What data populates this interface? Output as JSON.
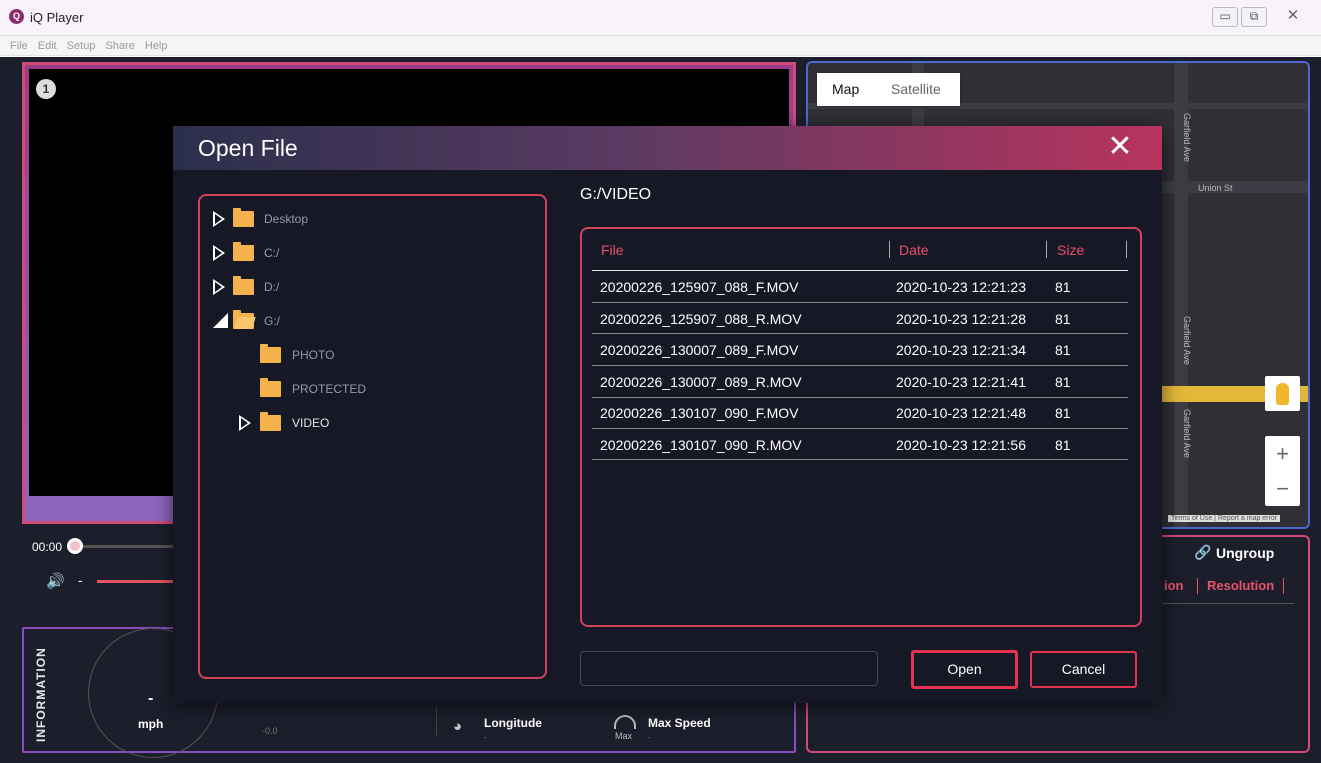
{
  "window": {
    "title": "iQ Player",
    "logo_glyph": "Q",
    "minimize_glyph": "▭",
    "maximize_glyph": "⧉",
    "close_glyph": "✕"
  },
  "menu": [
    "File",
    "Edit",
    "Setup",
    "Share",
    "Help"
  ],
  "player": {
    "camera_badge": "1",
    "time": "00:00",
    "volume_dash": "-",
    "volume_icon": "speaker-icon"
  },
  "information": {
    "label": "INFORMATION",
    "speed_value": "-",
    "speed_unit": "mph",
    "small_value": "-0.0",
    "longitude_label": "Longitude",
    "longitude_value": "-",
    "max_speed_label": "Max Speed",
    "max_speed_value": "-",
    "max_icon_label": "Max"
  },
  "map": {
    "tabs": [
      "Map",
      "Satellite"
    ],
    "streets": [
      "Union St",
      "Garfield Ave",
      "Garfield Ave",
      "Garfield Ave"
    ],
    "zoom_in": "+",
    "zoom_out": "−",
    "footer": "Terms of Use | Report a map error"
  },
  "list_panel": {
    "ungroup_label": "Ungroup",
    "partial_column": "ion",
    "resolution_column": "Resolution"
  },
  "dialog": {
    "title": "Open File",
    "close_glyph": "✕",
    "current_path": "G:/VIDEO",
    "tree": [
      {
        "label": "Desktop",
        "state": "collapsed",
        "level": 0
      },
      {
        "label": "C:/",
        "state": "collapsed",
        "level": 0
      },
      {
        "label": "D:/",
        "state": "collapsed",
        "level": 0
      },
      {
        "label": "G:/",
        "state": "expanded",
        "level": 0
      },
      {
        "label": "PHOTO",
        "state": "leaf",
        "level": 1
      },
      {
        "label": "PROTECTED",
        "state": "leaf",
        "level": 1
      },
      {
        "label": "VIDEO",
        "state": "collapsed",
        "level": 1
      }
    ],
    "columns": [
      "File",
      "Date",
      "Size"
    ],
    "files": [
      {
        "name": "20200226_125907_088_F.MOV",
        "date": "2020-10-23 12:21:23",
        "size": "81"
      },
      {
        "name": "20200226_125907_088_R.MOV",
        "date": "2020-10-23 12:21:28",
        "size": "81"
      },
      {
        "name": "20200226_130007_089_F.MOV",
        "date": "2020-10-23 12:21:34",
        "size": "81"
      },
      {
        "name": "20200226_130007_089_R.MOV",
        "date": "2020-10-23 12:21:41",
        "size": "81"
      },
      {
        "name": "20200226_130107_090_F.MOV",
        "date": "2020-10-23 12:21:48",
        "size": "81"
      },
      {
        "name": "20200226_130107_090_R.MOV",
        "date": "2020-10-23 12:21:56",
        "size": "81"
      }
    ],
    "filename_value": "",
    "open_label": "Open",
    "cancel_label": "Cancel"
  },
  "colors": {
    "accent_red": "#e3334f",
    "column_header": "#e8526b",
    "folder": "#f3b24b",
    "background": "#1c1e2c"
  }
}
